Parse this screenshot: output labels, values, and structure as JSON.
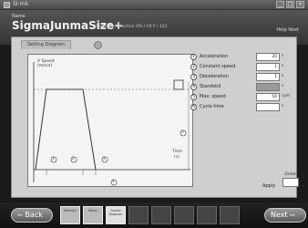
{
  "window": {
    "title": "SI-mk"
  },
  "header": {
    "small_label": "Name",
    "product_name": "SigmaJunmaSize+",
    "product_sub": "Sigma Ta Selection   VIS / V0 P / 101",
    "help_link": "Help Next"
  },
  "panel": {
    "tab_label": "Setting Diagram",
    "diagram": {
      "legend_lines": [
        "V Speed",
        "(mm/s)"
      ],
      "axis_end_label": "Time",
      "axis_end_unit": "(s)",
      "callouts": [
        "1",
        "2",
        "3",
        "4",
        "5"
      ]
    },
    "params": [
      {
        "num": "1",
        "label": "Acceleration",
        "value": "20",
        "unit": "s",
        "highlighted": false
      },
      {
        "num": "2",
        "label": "Constant speed",
        "value": "1",
        "unit": "s",
        "highlighted": false
      },
      {
        "num": "3",
        "label": "Deceleration",
        "value": "1",
        "unit": "s",
        "highlighted": false
      },
      {
        "num": "4",
        "label": "Standstill",
        "value": "",
        "unit": "s",
        "highlighted": true
      },
      {
        "num": "5",
        "label": "Max. speed",
        "value": "50",
        "unit": "rpm",
        "highlighted": false
      },
      {
        "num": "6",
        "label": "Cycle time",
        "value": "",
        "unit": "s",
        "highlighted": false
      }
    ],
    "apply_label": "Apply",
    "detail_label": "Detail"
  },
  "nav": {
    "back_label": "Back",
    "next_label": "Next",
    "steps": [
      {
        "label": "Machine",
        "state": "normal"
      },
      {
        "label": "Motor",
        "state": "normal"
      },
      {
        "label": "Speed Diagram",
        "state": "active"
      },
      {
        "label": "",
        "state": "dim"
      },
      {
        "label": "",
        "state": "dim"
      },
      {
        "label": "",
        "state": "dim"
      },
      {
        "label": "",
        "state": "dim"
      },
      {
        "label": "",
        "state": "dim"
      }
    ]
  }
}
